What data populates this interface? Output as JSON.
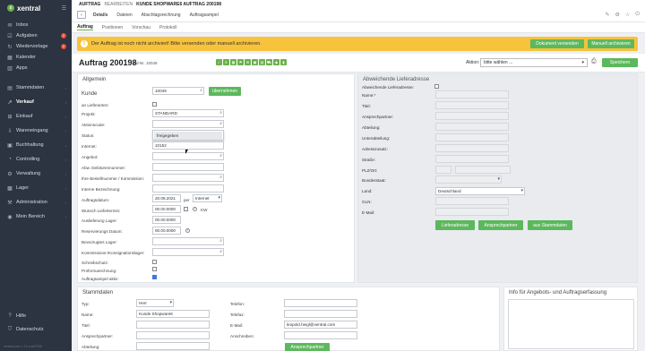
{
  "app": {
    "brand": "xentral",
    "version": "xentral.com v. 21.4.eb07f4b"
  },
  "sidebar": {
    "items1": [
      {
        "label": "Inbox",
        "icon": "inbox-icon",
        "glyph": "✉"
      },
      {
        "label": "Aufgaben",
        "icon": "check-icon",
        "glyph": "☑",
        "badge": "2"
      },
      {
        "label": "Wiedervorlage",
        "icon": "refresh-icon",
        "glyph": "↻",
        "badge": "2"
      },
      {
        "label": "Kalender",
        "icon": "calendar-icon",
        "glyph": "▦"
      },
      {
        "label": "Apps",
        "icon": "apps-icon",
        "glyph": "▥"
      }
    ],
    "items2": [
      {
        "label": "Stammdaten",
        "icon": "database-icon",
        "glyph": "▤"
      },
      {
        "label": "Verkauf",
        "icon": "sales-icon",
        "glyph": "↗",
        "active": true
      },
      {
        "label": "Einkauf",
        "icon": "cart-icon",
        "glyph": "⊞"
      },
      {
        "label": "Wareneingang",
        "icon": "inbox-arrow-icon",
        "glyph": "⇩"
      },
      {
        "label": "Buchhaltung",
        "icon": "book-icon",
        "glyph": "▣"
      },
      {
        "label": "Controlling",
        "icon": "chart-icon",
        "glyph": "◔"
      },
      {
        "label": "Verwaltung",
        "icon": "settings-icon",
        "glyph": "⚙"
      },
      {
        "label": "Lager",
        "icon": "warehouse-icon",
        "glyph": "▩"
      },
      {
        "label": "Administration",
        "icon": "admin-icon",
        "glyph": "⚒"
      },
      {
        "label": "Mein Bereich",
        "icon": "user-icon",
        "glyph": "◉"
      }
    ],
    "help": "Hilfe",
    "privacy": "Datenschutz"
  },
  "topbar": {
    "section": "AUFTRAG",
    "mode": "BEARBEITEN",
    "context": "KUNDE SHOPWARE6 AUFTRAG 200198"
  },
  "tabs": [
    "Details",
    "Dateien",
    "Abschlagsrechnung",
    "Auftragsampel"
  ],
  "subtabs": [
    "Auftrag",
    "Positionen",
    "Vorschau",
    "Protokoll"
  ],
  "warning": {
    "text": "Der Auftrag ist noch nicht archiviert! Bitte versenden oder manuell archivieren.",
    "btn1": "Dokument versenden",
    "btn2": "Manuell archivieren"
  },
  "header": {
    "title": "Auftrag 200198",
    "kd": "Kd-Nr. 10049",
    "aktion_label": "Aktion:",
    "aktion_value": "bitte wählen ...",
    "save": "Speichern"
  },
  "allgemein": {
    "title": "Allgemein",
    "kunde_label": "Kunde",
    "kunde_value": "10049",
    "uebernehmen": "übernehmen",
    "an_lieferanten": "an Lieferanten:",
    "projekt": "Projekt:",
    "projekt_value": "STANDARD",
    "aktionscode": "Aktionscode:",
    "status": "Status:",
    "status_value": "freigegeben",
    "internet": "Internet:",
    "internet_value": "10152",
    "angebot": "Angebot:",
    "abw_deb": "Abw. Debitorennummer:",
    "bestell": "Ihre Bestellnummer / Kommission:",
    "interne": "Interne Bezeichnung:",
    "auftragsdatum": "Auftragsdatum:",
    "auftragsdatum_value": "20.08.2021",
    "per": "per",
    "per_value": "Internet",
    "wunsch": "Wunsch Liefertermin:",
    "wunsch_value": "00.00.0000",
    "kw": "KW",
    "auslieferung": "Auslieferung Lager:",
    "auslieferung_value": "00.00.0000",
    "reservierung": "Reservierungs Datum:",
    "reservierung_value": "00.00.0000",
    "lager": "Bevorzugtes Lager:",
    "kommission": "Kommissions-/Konsignationslager:",
    "schreib": "Schreibschutz:",
    "proforma": "Proformarechnung:",
    "ampel": "Auftragsampel aktiv:"
  },
  "lieferadresse": {
    "title": "Abweichende Lieferadresse",
    "fields": [
      "Abweichende Lieferadresse:",
      "Name:*",
      "Titel:",
      "Ansprechpartner:",
      "Abteilung:",
      "Unterabteilung:",
      "Adresszusatz:",
      "Straße:",
      "PLZ/Ort:",
      "Bundesstaat:",
      "Land:",
      "GLN:",
      "E-Mail:"
    ],
    "land_value": "Deutschland",
    "btn1": "Lieferadresse",
    "btn2": "Ansprechpartner",
    "btn3": "aus Stammdaten"
  },
  "stammdaten": {
    "title": "Stammdaten",
    "typ": "Typ:",
    "typ_value": "Herr",
    "name": "Name:",
    "name_value": "Kunde Shopware6",
    "titel": "Titel:",
    "ansprech": "Ansprechpartner:",
    "abteilung": "Abteilung:",
    "telefon": "Telefon:",
    "telefax": "Telefax:",
    "email": "E-Mail:",
    "email_value": "leopold.heigl@xentral.com",
    "anschreiben": "Anschreiben:",
    "btn": "Ansprechpartner"
  },
  "info": {
    "title": "Info für Angebots- und Auftragserfassung"
  },
  "colors": {
    "sidebar": "#2b3440",
    "accent": "#6ab04c",
    "warning": "#f7c23c",
    "button": "#5cb85c"
  }
}
